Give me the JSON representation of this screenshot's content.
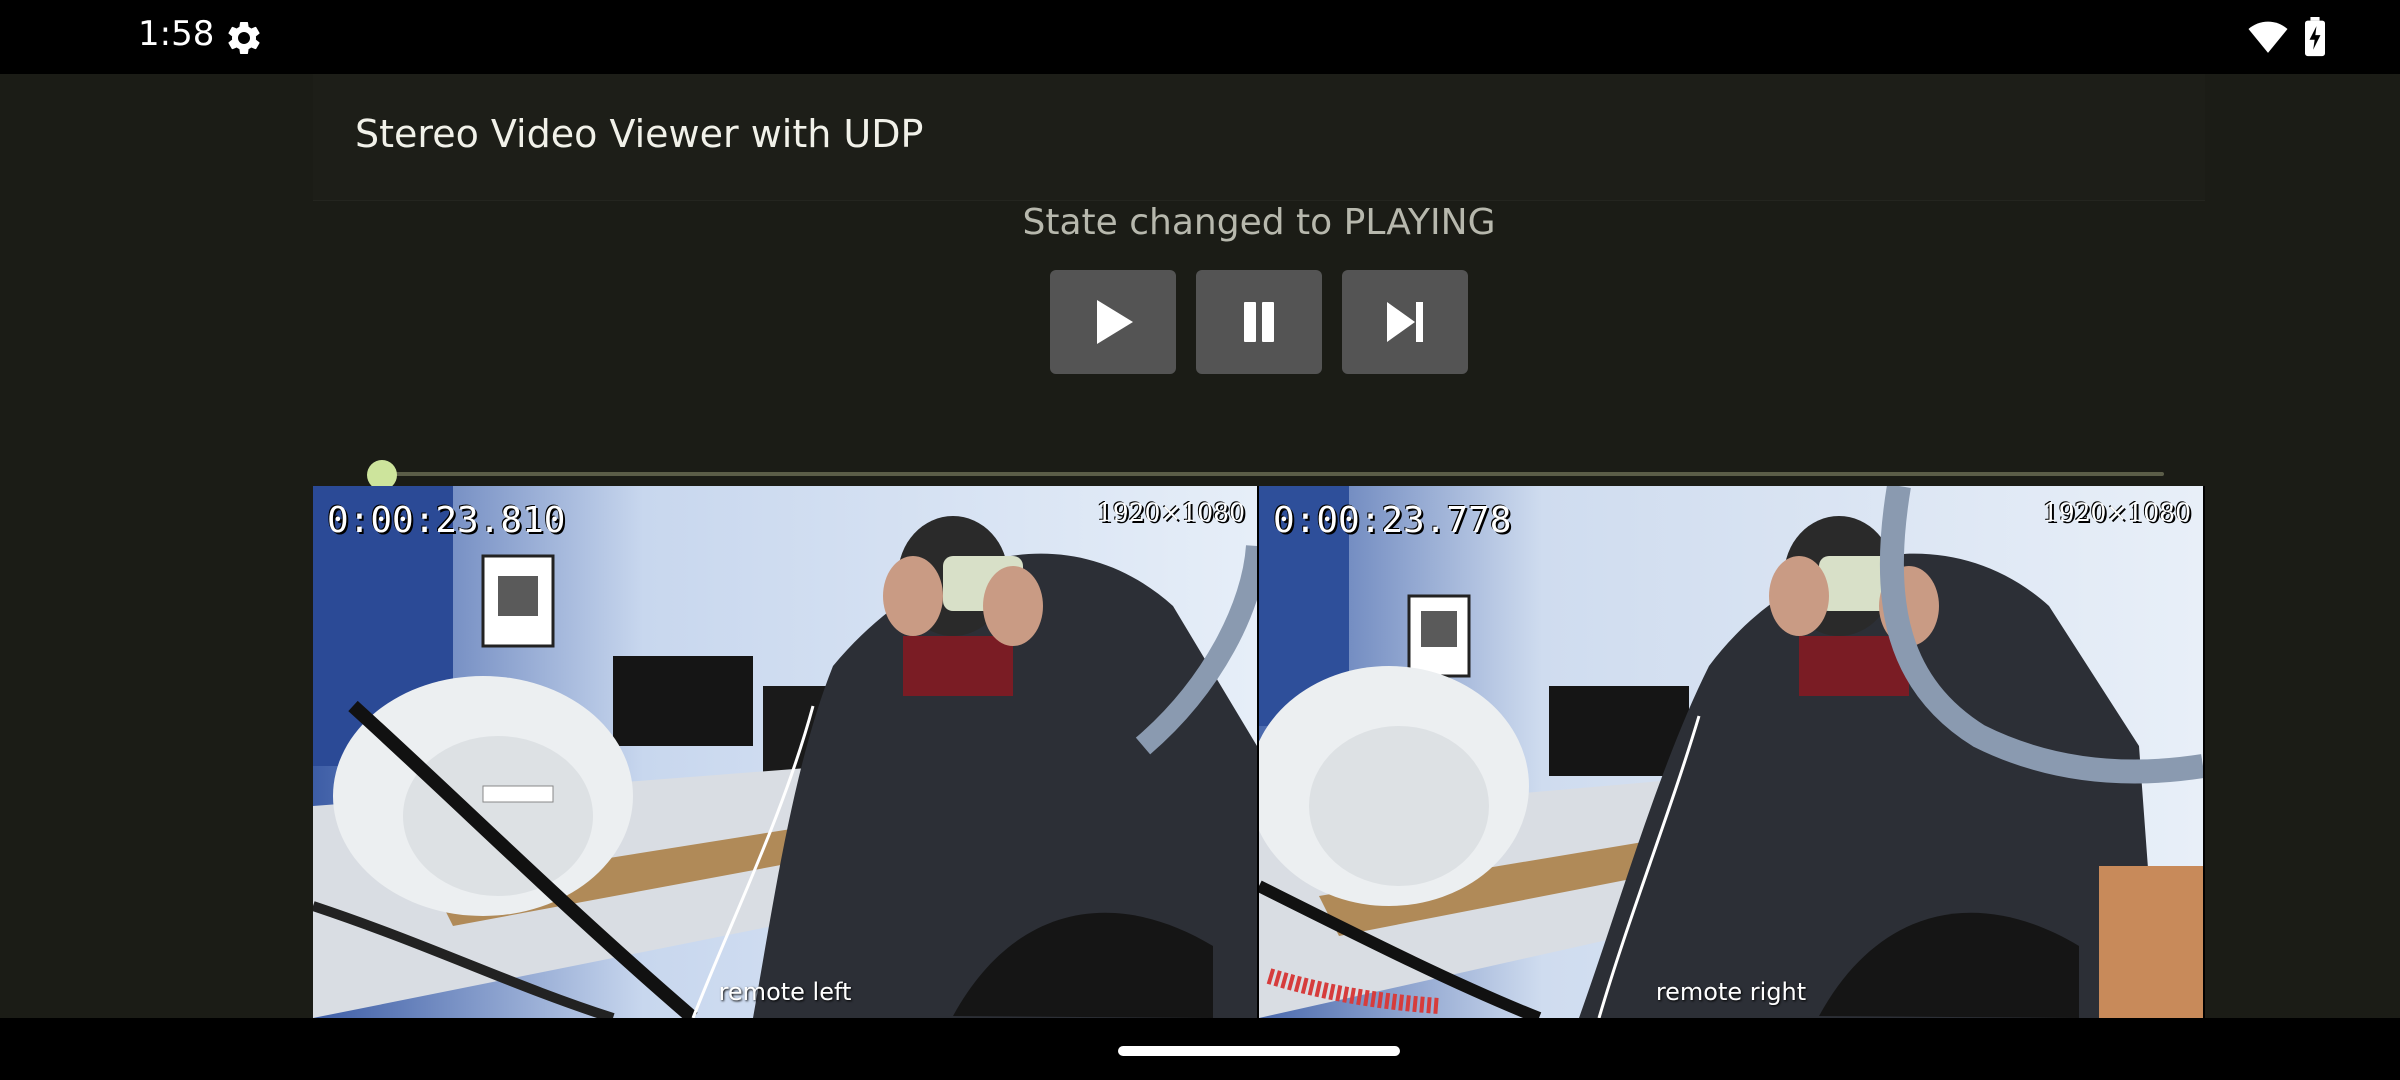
{
  "status_bar": {
    "time": "1:58",
    "icons": [
      "gear-icon",
      "wifi-icon",
      "battery-charging-icon"
    ]
  },
  "app_bar": {
    "title": "Stereo Video Viewer with UDP"
  },
  "player": {
    "state_text": "State changed to PLAYING",
    "buttons": [
      {
        "name": "play-button",
        "icon": "play-icon"
      },
      {
        "name": "pause-button",
        "icon": "pause-icon"
      },
      {
        "name": "skip-next-button",
        "icon": "skip-next-icon"
      }
    ],
    "progress_fraction": 0.0,
    "accent_color": "#cde49c"
  },
  "videos": {
    "left": {
      "timestamp": "0:00:23.810",
      "resolution": "1920×1080",
      "label": "remote left"
    },
    "right": {
      "timestamp": "0:00:23.778",
      "resolution": "1920×1080",
      "label": "remote right"
    }
  }
}
